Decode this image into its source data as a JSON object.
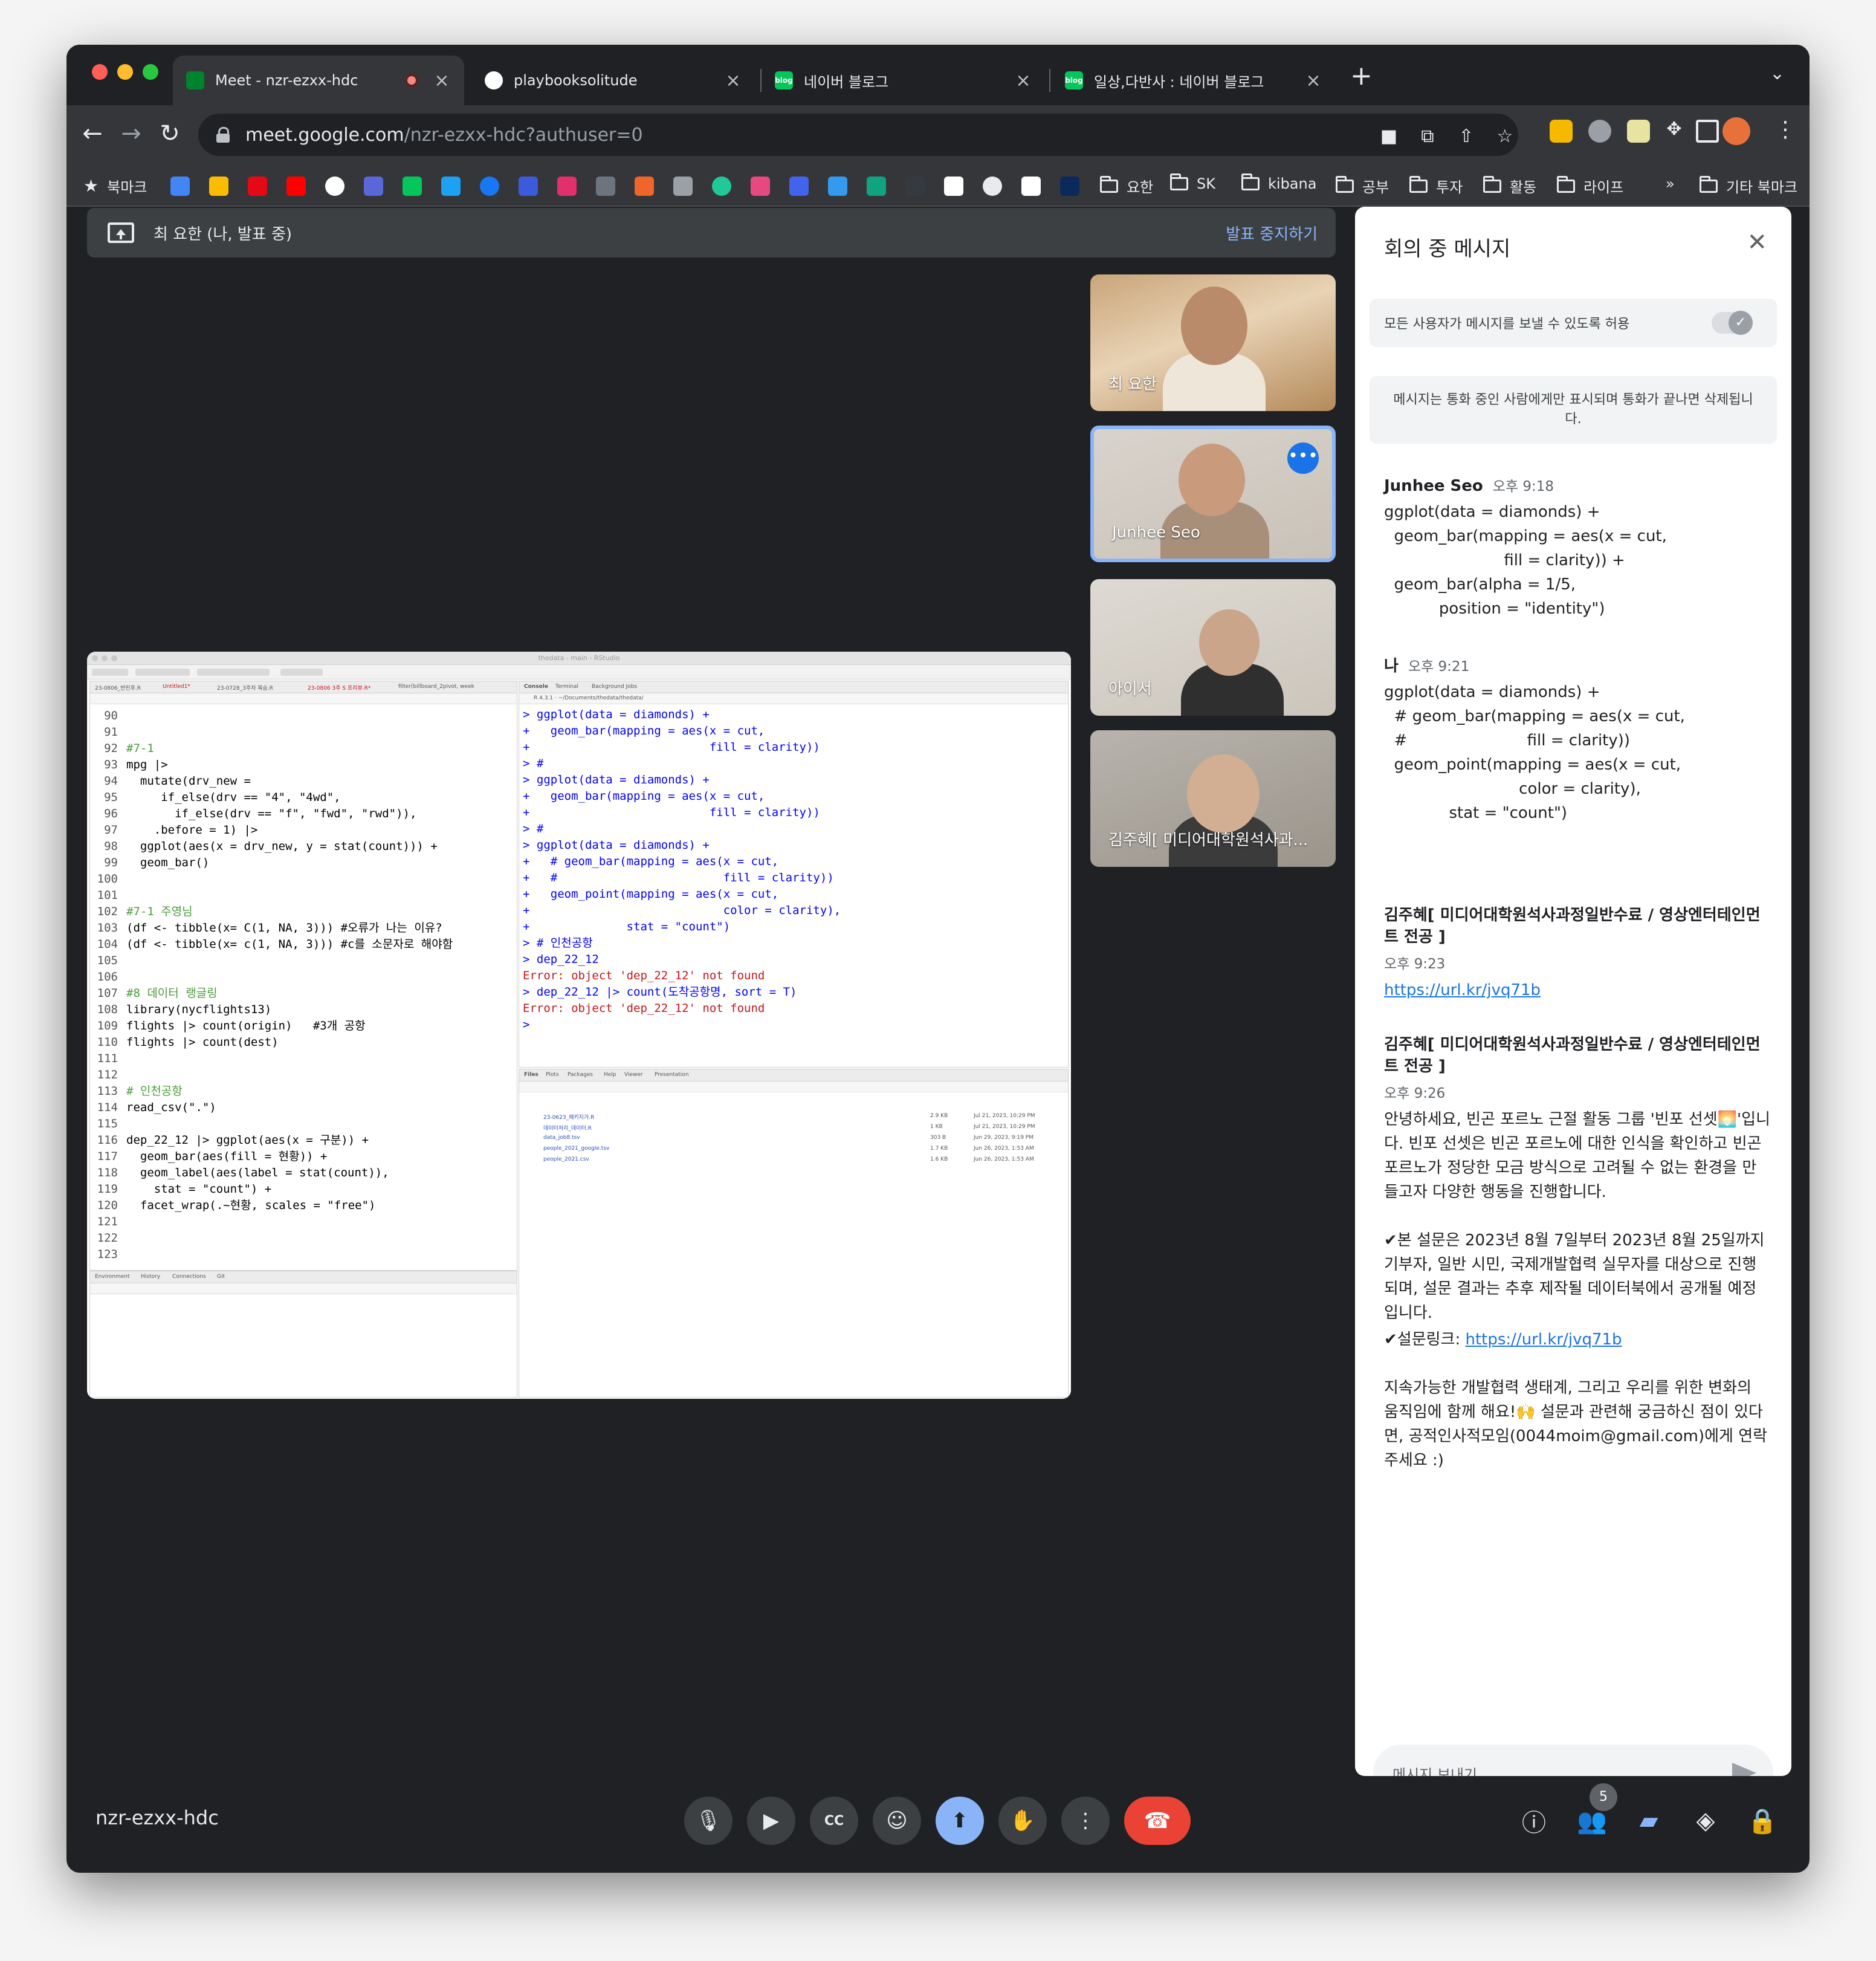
{
  "browser": {
    "tabs": [
      {
        "label": "Meet - nzr-ezxx-hdc",
        "active": true
      },
      {
        "label": "playbooksolitude",
        "active": false
      },
      {
        "label": "네이버 블로그",
        "active": false
      },
      {
        "label": "일상,다반사 : 네이버 블로그",
        "active": false
      }
    ],
    "url_host": "meet.google.com",
    "url_path": "/nzr-ezxx-hdc?authuser=0",
    "bookmarks": {
      "first": "북마크",
      "folders": [
        "요한",
        "SK",
        "kibana",
        "공부",
        "투자",
        "활동",
        "라이프"
      ],
      "overflow": "»",
      "other": "기타 북마크"
    }
  },
  "meet": {
    "presenting_label": "최 요한 (나, 발표 중)",
    "stop_presenting": "발표 중지하기",
    "meeting_code": "nzr-ezxx-hdc",
    "participant_count": "5",
    "participants": [
      {
        "name": "최 요한"
      },
      {
        "name": "Junhee Seo",
        "more": "•••"
      },
      {
        "name": "아이서"
      },
      {
        "name": "김주혜[ 미디어대학원석사과..."
      }
    ]
  },
  "rstudio": {
    "title": "thedata - main - RStudio",
    "editor_tabs": [
      "23-0806_반민후.R",
      "Untitled1*",
      "23-0728_3주차 복습.R",
      "23-0806 3주 S 프리뷰.R*",
      "filter(billboard_2pivot, week"
    ],
    "editor_lines": [
      {
        "n": "90",
        "t": ""
      },
      {
        "n": "91",
        "t": ""
      },
      {
        "n": "92",
        "t": "#7-1"
      },
      {
        "n": "93",
        "t": "mpg |>"
      },
      {
        "n": "94",
        "t": "  mutate(drv_new ="
      },
      {
        "n": "95",
        "t": "     if_else(drv == \"4\", \"4wd\","
      },
      {
        "n": "96",
        "t": "       if_else(drv == \"f\", \"fwd\", \"rwd\")),"
      },
      {
        "n": "97",
        "t": "    .before = 1) |>"
      },
      {
        "n": "98",
        "t": "  ggplot(aes(x = drv_new, y = stat(count))) +"
      },
      {
        "n": "99",
        "t": "  geom_bar()"
      },
      {
        "n": "100",
        "t": ""
      },
      {
        "n": "101",
        "t": ""
      },
      {
        "n": "102",
        "t": "#7-1 주영님"
      },
      {
        "n": "103",
        "t": "(df <- tibble(x= C(1, NA, 3))) #오류가 나는 이유?"
      },
      {
        "n": "104",
        "t": "(df <- tibble(x= c(1, NA, 3))) #c를 소문자로 해야함"
      },
      {
        "n": "105",
        "t": ""
      },
      {
        "n": "106",
        "t": ""
      },
      {
        "n": "107",
        "t": "#8 데이터 랭글링"
      },
      {
        "n": "108",
        "t": "library(nycflights13)"
      },
      {
        "n": "109",
        "t": "flights |> count(origin)   #3개 공항"
      },
      {
        "n": "110",
        "t": "flights |> count(dest)"
      },
      {
        "n": "111",
        "t": ""
      },
      {
        "n": "112",
        "t": ""
      },
      {
        "n": "113",
        "t": "# 인천공항"
      },
      {
        "n": "114",
        "t": "read_csv(\".\")"
      },
      {
        "n": "115",
        "t": ""
      },
      {
        "n": "116",
        "t": "dep_22_12 |> ggplot(aes(x = 구분)) +"
      },
      {
        "n": "117",
        "t": "  geom_bar(aes(fill = 현황)) +"
      },
      {
        "n": "118",
        "t": "  geom_label(aes(label = stat(count)),"
      },
      {
        "n": "119",
        "t": "    stat = \"count\") +"
      },
      {
        "n": "120",
        "t": "  facet_wrap(.~현황, scales = \"free\")"
      },
      {
        "n": "121",
        "t": ""
      },
      {
        "n": "122",
        "t": ""
      },
      {
        "n": "123",
        "t": ""
      }
    ],
    "console_tabs": [
      "Console",
      "Terminal",
      "Background Jobs"
    ],
    "console_path": "R 4.3.1 · ~/Documents/thedata/thedata/",
    "console_lines": [
      "> ggplot(data = diamonds) +",
      "+   geom_bar(mapping = aes(x = cut,",
      "+                          fill = clarity))",
      "> #",
      "> ggplot(data = diamonds) +",
      "+   geom_bar(mapping = aes(x = cut,",
      "+                          fill = clarity))",
      "> #",
      "> ggplot(data = diamonds) +",
      "+   # geom_bar(mapping = aes(x = cut,",
      "+   #                        fill = clarity))",
      "+   geom_point(mapping = aes(x = cut,",
      "+                            color = clarity),",
      "+              stat = \"count\")",
      "> # 인천공항",
      "> dep_22_12",
      "Error: object 'dep_22_12' not found",
      "> dep_22_12 |> count(도착공항명, sort = T)",
      "Error: object 'dep_22_12' not found",
      ">"
    ],
    "files_tabs": [
      "Files",
      "Plots",
      "Packages",
      "Help",
      "Viewer",
      "Presentation"
    ],
    "files": [
      {
        "name": "23-0623_패키지가.R",
        "size": "2.9 KB",
        "modified": "Jul 21, 2023, 10:29 PM"
      },
      {
        "name": "데이터처리_데이터.R",
        "size": "1 KB",
        "modified": "Jul 21, 2023, 10:29 PM"
      },
      {
        "name": "data_job8.tsv",
        "size": "303 B",
        "modified": "Jun 29, 2023, 9:19 PM"
      },
      {
        "name": "people_2021_google.tsv",
        "size": "1.7 KB",
        "modified": "Jun 26, 2023, 1:53 AM"
      },
      {
        "name": "people_2021.csv",
        "size": "1.6 KB",
        "modified": "Jun 26, 2023, 1:53 AM"
      }
    ],
    "env_tabs": [
      "Environment",
      "History",
      "Connections",
      "Git"
    ]
  },
  "chat": {
    "title": "회의 중 메시지",
    "allow_label": "모든 사용자가 메시지를 보낼 수 있도록 허용",
    "notice": "메시지는 통화 중인 사람에게만 표시되며 통화가 끝나면 삭제됩니다.",
    "messages": [
      {
        "sender": "Junhee Seo",
        "time": "오후 9:18",
        "text": "ggplot(data = diamonds) +\n  geom_bar(mapping = aes(x = cut,\n                        fill = clarity)) +\n  geom_bar(alpha = 1/5,\n           position = \"identity\")"
      },
      {
        "sender": "나",
        "time": "오후 9:21",
        "text": "ggplot(data = diamonds) +\n  # geom_bar(mapping = aes(x = cut,\n  #                        fill = clarity))\n  geom_point(mapping = aes(x = cut,\n                           color = clarity),\n             stat = \"count\")"
      },
      {
        "sender": "김주혜[ 미디어대학원석사과정일반수료 / 영상엔터테인먼트 전공 ]",
        "time": "오후 9:23",
        "link": "https://url.kr/jvq71b"
      },
      {
        "sender": "김주혜[ 미디어대학원석사과정일반수료 / 영상엔터테인먼트 전공 ]",
        "time": "오후 9:26",
        "p1": "안녕하세요, 빈곤 포르노 근절 활동 그룹 '빈포 선셋🌅'입니다. 빈포 선셋은 빈곤 포르노에 대한 인식을 확인하고 빈곤 포르노가 정당한 모금 방식으로 고려될 수 없는 환경을 만들고자 다양한 행동을 진행합니다.",
        "p2": "✔본 설문은 2023년 8월 7일부터 2023년 8월 25일까지 기부자, 일반 시민, 국제개발협력 실무자를 대상으로 진행되며, 설문 결과는 추후 제작될 데이터북에서 공개될 예정입니다.",
        "p3_prefix": "✔설문링크: ",
        "p3_link": "https://url.kr/jvq71b",
        "p4": "지속가능한 개발협력 생태계, 그리고 우리를 위한 변화의 움직임에 함께 해요!🙌 설문과 관련해 궁금하신 점이 있다면, 공적인사적모임(0044moim@gmail.com)에게 연락주세요 :)"
      }
    ],
    "input_placeholder": "메시지 보내기"
  }
}
